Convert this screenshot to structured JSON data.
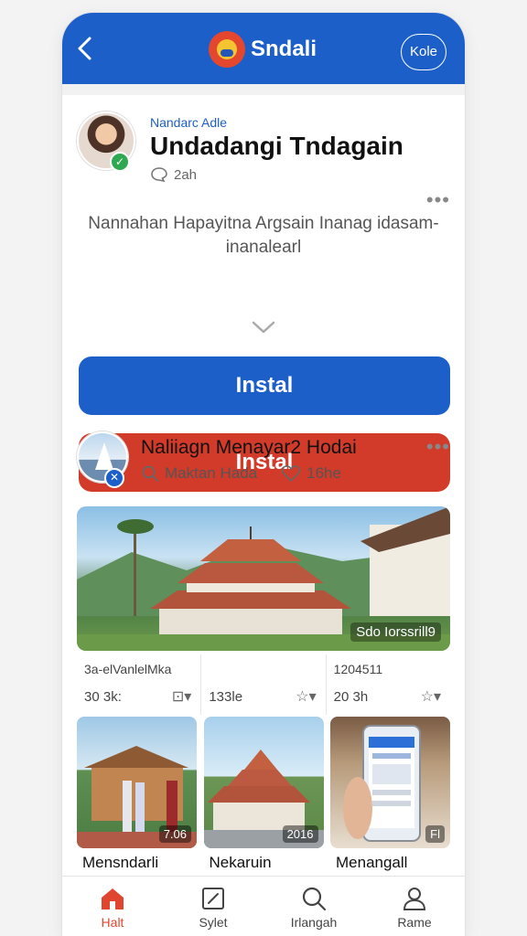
{
  "app": {
    "brand_name": "Sndali",
    "header_button": "Kole",
    "accent": "#1d5fc9",
    "danger": "#d23a2a"
  },
  "post1": {
    "subtitle": "Nandarc Adle",
    "title": "Undadangi Tndagain",
    "time": "2ah",
    "description": "Nannahan Hapayitna Argsain Inanag idasam-inanalearl",
    "install_primary": "Instal",
    "install_secondary": "Instal"
  },
  "post2": {
    "title": "Naliiagn Menayar2 Hodai",
    "meta_left": "Maktan Hada",
    "meta_right": "16he",
    "hero_caption": "Sdo Iorssrill9",
    "stats": [
      {
        "label": "3a-elVanlelMka",
        "value": "30 3k:"
      },
      {
        "label": "",
        "value": "133le"
      },
      {
        "label": "1204511",
        "value": "20 3h"
      }
    ],
    "tiles": [
      {
        "label": "Mensndarli",
        "badge": "7.06"
      },
      {
        "label": "Nekaruin",
        "badge": "2016"
      },
      {
        "label": "Menangall",
        "badge": "Fl"
      }
    ]
  },
  "nav": [
    {
      "label": "Halt",
      "icon": "home-icon"
    },
    {
      "label": "Sylet",
      "icon": "edit-icon"
    },
    {
      "label": "Irlangah",
      "icon": "search-icon"
    },
    {
      "label": "Rame",
      "icon": "person-icon"
    }
  ]
}
